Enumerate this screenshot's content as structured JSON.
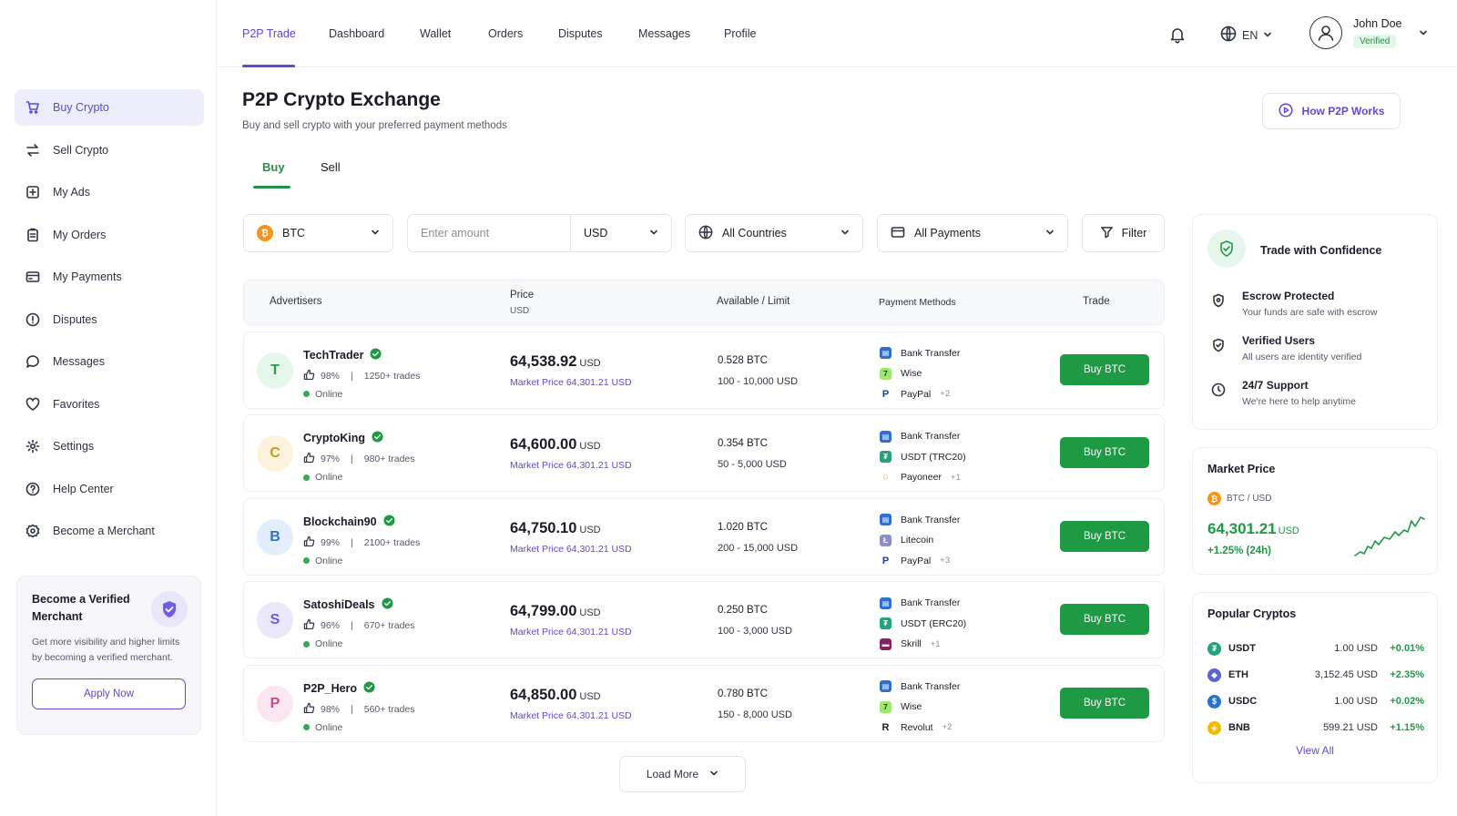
{
  "topnav": {
    "tabs": [
      {
        "label": "P2P Trade"
      },
      {
        "label": "Dashboard"
      },
      {
        "label": "Wallet"
      },
      {
        "label": "Orders"
      },
      {
        "label": "Disputes"
      },
      {
        "label": "Messages"
      },
      {
        "label": "Profile"
      }
    ],
    "language": "EN",
    "user_name": "John Doe",
    "user_status": "Verified"
  },
  "sidebar": {
    "items": [
      {
        "label": "Buy Crypto",
        "icon": "cart-icon"
      },
      {
        "label": "Sell Crypto",
        "icon": "swap-icon"
      },
      {
        "label": "My Ads",
        "icon": "ads-icon"
      },
      {
        "label": "My Orders",
        "icon": "clipboard-icon"
      },
      {
        "label": "My Payments",
        "icon": "card-icon"
      },
      {
        "label": "Disputes",
        "icon": "alert-icon"
      },
      {
        "label": "Messages",
        "icon": "chat-icon"
      },
      {
        "label": "Favorites",
        "icon": "heart-icon"
      },
      {
        "label": "Settings",
        "icon": "gear-icon"
      },
      {
        "label": "Help Center",
        "icon": "help-icon"
      },
      {
        "label": "Become a Merchant",
        "icon": "merchant-icon"
      }
    ],
    "promo": {
      "title": "Become a Verified Merchant",
      "text": "Get more visibility and higher limits by becoming a verified merchant.",
      "button": "Apply Now"
    }
  },
  "header": {
    "title": "P2P Crypto Exchange",
    "subtitle": "Buy and sell crypto with your preferred payment methods",
    "how_button": "How P2P Works",
    "buy_tab": "Buy",
    "sell_tab": "Sell"
  },
  "filters": {
    "coin": "BTC",
    "amount_placeholder": "Enter amount",
    "currency": "USD",
    "countries": "All Countries",
    "payments": "All Payments",
    "filter": "Filter"
  },
  "table": {
    "headers": {
      "advertisers": "Advertisers",
      "price": "Price",
      "price_unit": "USD",
      "available": "Available / Limit",
      "payment": "Payment Methods",
      "trade": "Trade"
    },
    "rows": [
      {
        "initial": "T",
        "name": "TechTrader",
        "rating": "98%",
        "sep": "|",
        "trades": "1250+ trades",
        "status": "Online",
        "price": "64,538.92",
        "unit": "USD",
        "market": "Market Price 64,301.21 USD",
        "available": "0.528 BTC",
        "limit": "100 - 10,000 USD",
        "payments": [
          "Bank Transfer",
          "Wise",
          "PayPal"
        ],
        "more": "+2",
        "button": "Buy BTC"
      },
      {
        "initial": "C",
        "name": "CryptoKing",
        "rating": "97%",
        "sep": "|",
        "trades": "980+ trades",
        "status": "Online",
        "price": "64,600.00",
        "unit": "USD",
        "market": "Market Price 64,301.21 USD",
        "available": "0.354 BTC",
        "limit": "50 - 5,000 USD",
        "payments": [
          "Bank Transfer",
          "USDT (TRC20)",
          "Payoneer"
        ],
        "more": "+1",
        "button": "Buy BTC"
      },
      {
        "initial": "B",
        "name": "Blockchain90",
        "rating": "99%",
        "sep": "|",
        "trades": "2100+ trades",
        "status": "Online",
        "price": "64,750.10",
        "unit": "USD",
        "market": "Market Price 64,301.21 USD",
        "available": "1.020 BTC",
        "limit": "200 - 15,000 USD",
        "payments": [
          "Bank Transfer",
          "Litecoin",
          "PayPal"
        ],
        "more": "+3",
        "button": "Buy BTC"
      },
      {
        "initial": "S",
        "name": "SatoshiDeals",
        "rating": "96%",
        "sep": "|",
        "trades": "670+ trades",
        "status": "Online",
        "price": "64,799.00",
        "unit": "USD",
        "market": "Market Price 64,301.21 USD",
        "available": "0.250 BTC",
        "limit": "100 - 3,000 USD",
        "payments": [
          "Bank Transfer",
          "USDT (ERC20)",
          "Skrill"
        ],
        "more": "+1",
        "button": "Buy BTC"
      },
      {
        "initial": "P",
        "name": "P2P_Hero",
        "rating": "98%",
        "sep": "|",
        "trades": "560+ trades",
        "status": "Online",
        "price": "64,850.00",
        "unit": "USD",
        "market": "Market Price 64,301.21 USD",
        "available": "0.780 BTC",
        "limit": "150 - 8,000 USD",
        "payments": [
          "Bank Transfer",
          "Wise",
          "Revolut"
        ],
        "more": "+2",
        "button": "Buy BTC"
      }
    ],
    "load_more": "Load More"
  },
  "confidence": {
    "title": "Trade with Confidence",
    "features": [
      {
        "title": "Escrow Protected",
        "text": "Your funds are safe with escrow"
      },
      {
        "title": "Verified Users",
        "text": "All users are identity verified"
      },
      {
        "title": "24/7 Support",
        "text": "We're here to help anytime"
      }
    ]
  },
  "market": {
    "title": "Market Price",
    "pair": "BTC / USD",
    "price": "64,301.21",
    "unit": "USD",
    "change": "+1.25% (24h)"
  },
  "popular": {
    "title": "Popular Cryptos",
    "items": [
      {
        "symbol": "USDT",
        "price": "1.00 USD",
        "change": "+0.01%",
        "color": "#26a17b"
      },
      {
        "symbol": "ETH",
        "price": "3,152.45 USD",
        "change": "+2.35%",
        "color": "#5a67c9"
      },
      {
        "symbol": "USDC",
        "price": "1.00 USD",
        "change": "+0.02%",
        "color": "#2775ca"
      },
      {
        "symbol": "BNB",
        "price": "599.21 USD",
        "change": "+1.15%",
        "color": "#f0b90b"
      }
    ],
    "view_all": "View All"
  },
  "colors": {
    "accent": "#5b4bd6",
    "green": "#1f9a44",
    "btc": "#f7931a"
  }
}
